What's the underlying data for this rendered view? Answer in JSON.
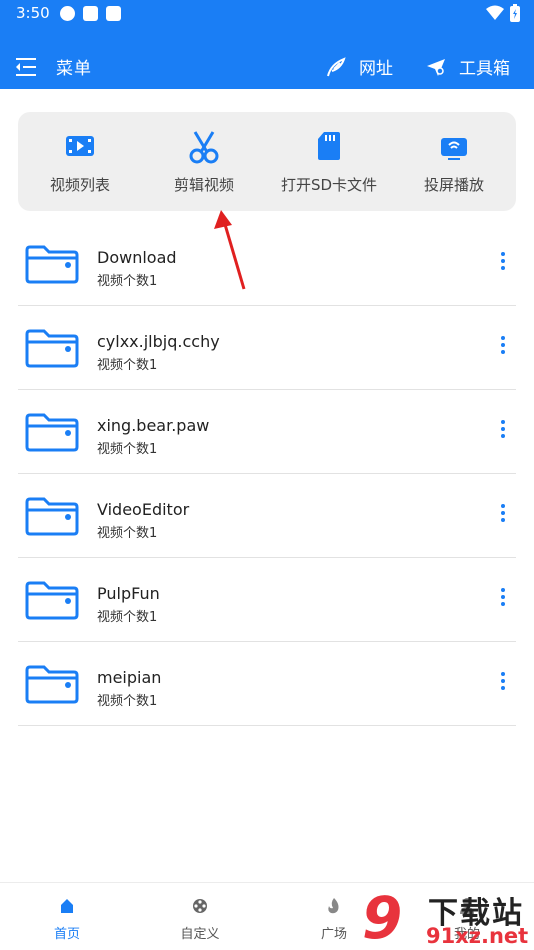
{
  "status_bar": {
    "time": "3:50"
  },
  "app_bar": {
    "menu_label": "菜单",
    "url_label": "网址",
    "tools_label": "工具箱"
  },
  "quick_actions": [
    {
      "label": "视频列表",
      "icon": "video-list-icon"
    },
    {
      "label": "剪辑视频",
      "icon": "scissors-icon"
    },
    {
      "label": "打开SD卡文件",
      "icon": "sd-card-icon"
    },
    {
      "label": "投屏播放",
      "icon": "cast-screen-icon"
    }
  ],
  "folders": [
    {
      "name": "Download",
      "count": "视频个数1"
    },
    {
      "name": "cylxx.jlbjq.cchy",
      "count": "视频个数1"
    },
    {
      "name": "xing.bear.paw",
      "count": "视频个数1"
    },
    {
      "name": "VideoEditor",
      "count": "视频个数1"
    },
    {
      "name": "PulpFun",
      "count": "视频个数1"
    },
    {
      "name": "meipian",
      "count": "视频个数1"
    }
  ],
  "bottom_nav": [
    {
      "label": "首页",
      "icon": "home-icon",
      "active": true
    },
    {
      "label": "自定义",
      "icon": "film-reel-icon",
      "active": false
    },
    {
      "label": "广场",
      "icon": "flame-icon",
      "active": false
    },
    {
      "label": "我的",
      "icon": "person-icon",
      "active": false
    }
  ],
  "watermark": {
    "logo": "9",
    "text": "下载站",
    "domain": "91xz.net"
  },
  "colors": {
    "primary": "#1a7ef5",
    "annotation_arrow": "#e02020",
    "watermark_red": "#e8333d"
  }
}
